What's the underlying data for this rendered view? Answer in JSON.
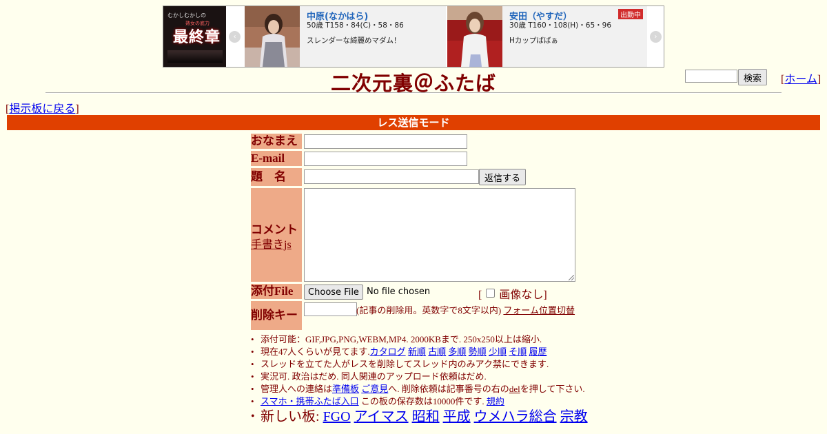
{
  "ads": {
    "logo_small": "むかしむかしの",
    "logo_big": "最終章",
    "logo_tag": "熟女の底力",
    "prev_glyph": "‹",
    "next_glyph": "›",
    "cards": [
      {
        "name": "中原(なかはら)",
        "stats": "50歳 T158・84(C)・58・86",
        "desc": "スレンダーな綺麗めマダム！",
        "badge": ""
      },
      {
        "name": "安田（やすだ）",
        "stats": "30歳 T160・108(H)・65・96",
        "desc": "Hカップばばぁ",
        "badge": "出勤中"
      }
    ]
  },
  "header": {
    "title": "二次元裏＠ふたば",
    "search_button": "検索",
    "home_prefix": "[",
    "home_link": "ホーム",
    "home_suffix": "]"
  },
  "back": {
    "prefix": "[",
    "link": "掲示板に戻る",
    "suffix": "]"
  },
  "mode_bar": "レス送信モード",
  "form": {
    "name_label": "おなまえ",
    "email_label": "E-mail",
    "subject_label": "題　名",
    "submit_button": "返信する",
    "comment_label": "コメント",
    "handwriting_link": "手書きjs",
    "file_label": "添付File",
    "choose_file_button": "Choose File",
    "file_status": "No file chosen",
    "noimage_open": "[",
    "noimage_label": "画像なし",
    "noimage_close": "]",
    "delkey_label": "削除キー",
    "delkey_note": "(記事の削除用。英数字で8文字以内)",
    "form_position_link": "フォーム位置切替"
  },
  "notes": {
    "n1": "添付可能：GIF,JPG,PNG,WEBM,MP4. 2000KBまで. 250x250以上は縮小.",
    "n2_prefix": "現在47人くらいが見てます.",
    "n2_links": [
      "カタログ",
      "新順",
      "古順",
      "多順",
      "勢順",
      "少順",
      "そ順",
      "履歴"
    ],
    "n3": "スレッドを立てた人がレスを削除してスレッド内のみアク禁にできます.",
    "n4": "実況可. 政治はだめ. 同人関連のアップロード依頼はだめ.",
    "n5_a": "管理人への連絡は",
    "n5_link1": "準備板",
    "n5_b": " ",
    "n5_link2": "ご意見",
    "n5_c": "へ. 削除依頼は記事番号の右の",
    "n5_link3": "del",
    "n5_d": "を押して下さい.",
    "n6_link1": "スマホ・携帯ふたば入口",
    "n6_text": " この板の保存数は10000件です. ",
    "n6_link2": "規約",
    "n7_prefix": "新しい板: ",
    "n7_links": [
      "FGO",
      "アイマス",
      "昭和",
      "平成",
      "ウメハラ総合",
      "宗教"
    ]
  }
}
